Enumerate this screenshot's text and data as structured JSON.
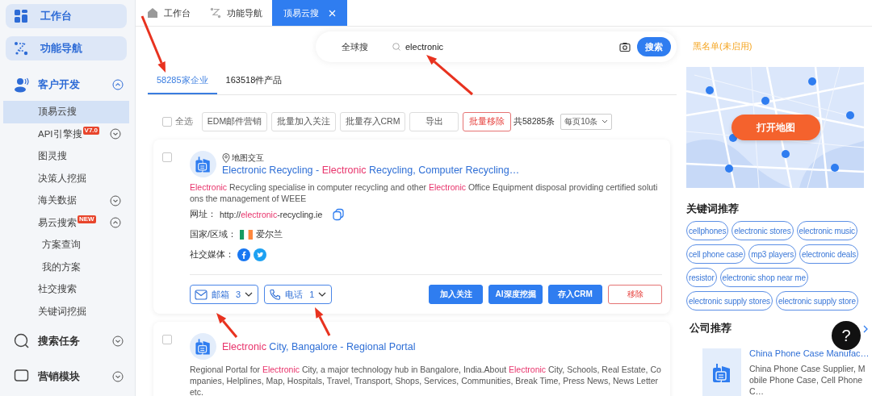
{
  "sidebar": {
    "pinned": [
      {
        "label": "工作台",
        "kind": "workbench"
      },
      {
        "label": "功能导航",
        "kind": "navigation"
      }
    ],
    "groups": [
      {
        "label": "客户开发",
        "kind": "customer",
        "expanded": true,
        "items": [
          {
            "label": "顶易云搜",
            "selected": true
          },
          {
            "label": "API引擎搜",
            "selected": false,
            "badge": "V7.0",
            "expanded": false
          },
          {
            "label": "图灵搜",
            "selected": false
          },
          {
            "label": "决策人挖掘",
            "selected": false
          },
          {
            "label": "海关数据",
            "selected": false,
            "expanded": false
          },
          {
            "label": "易云搜索",
            "selected": false,
            "badge": "NEW",
            "expanded": true,
            "children": [
              {
                "label": "方案查询",
                "selected": false
              },
              {
                "label": "我的方案",
                "selected": false
              }
            ]
          },
          {
            "label": "社交搜索",
            "selected": false
          },
          {
            "label": "关键词挖掘",
            "selected": false
          }
        ]
      },
      {
        "label": "搜索任务",
        "kind": "search",
        "expanded": false
      },
      {
        "label": "营销模块",
        "kind": "marketing",
        "expanded": false
      }
    ]
  },
  "tabs": [
    {
      "label": "工作台",
      "kind": "home",
      "selected": false
    },
    {
      "label": "功能导航",
      "kind": "navigation",
      "selected": false
    },
    {
      "label": "顶易云搜",
      "kind": "page",
      "selected": true
    }
  ],
  "search": {
    "scope": "全球搜",
    "value": "electronic",
    "button": "搜索"
  },
  "result_tabs": [
    {
      "label": "58285家企业",
      "selected": true
    },
    {
      "label": "163518件产品",
      "selected": false
    }
  ],
  "toolbar": {
    "select_all": {
      "label": "全选",
      "checked": false
    },
    "buttons": [
      {
        "label": "EDM邮件营销",
        "kind": "default"
      },
      {
        "label": "批量加入关注",
        "kind": "default"
      },
      {
        "label": "批量存入CRM",
        "kind": "default"
      },
      {
        "label": "导出",
        "kind": "default"
      },
      {
        "label": "批量移除",
        "kind": "danger"
      }
    ],
    "total": "共58285条",
    "page_size": "每页10条"
  },
  "results": [
    {
      "checked": false,
      "map_label": "地图交互",
      "title": [
        {
          "text": "Electronic Recycling - ",
          "highlight": false
        },
        {
          "text": "Electronic",
          "highlight": true
        },
        {
          "text": " Recycling, Computer Recycling…",
          "highlight": false
        }
      ],
      "description": [
        {
          "text": "Electronic",
          "highlight": true
        },
        {
          "text": " Recycling specialise in computer recycling and other ",
          "highlight": false
        },
        {
          "text": "Electronic",
          "highlight": true
        },
        {
          "text": " Office Equipment disposal providing certified solutions the management of WEEE",
          "highlight": false
        }
      ],
      "website": {
        "label": "网址：",
        "value": [
          {
            "text": "http://",
            "highlight": false
          },
          {
            "text": "electronic",
            "highlight": true
          },
          {
            "text": "-recycling.ie",
            "highlight": false
          }
        ]
      },
      "country": {
        "label": "国家/区域：",
        "value": "爱尔兰"
      },
      "social": {
        "label": "社交媒体：",
        "networks": [
          {
            "kind": "facebook"
          },
          {
            "kind": "twitter"
          }
        ]
      },
      "contacts": [
        {
          "kind": "email",
          "label": "邮箱",
          "count": "3"
        },
        {
          "kind": "phone",
          "label": "电话",
          "count": "1"
        }
      ],
      "actions": [
        {
          "label": "加入关注",
          "kind": "primary"
        },
        {
          "label": "AI深度挖掘",
          "kind": "primary"
        },
        {
          "label": "存入CRM",
          "kind": "primary"
        },
        {
          "label": "移除",
          "kind": "danger"
        }
      ]
    },
    {
      "checked": false,
      "title": [
        {
          "text": "Electronic",
          "highlight": true
        },
        {
          "text": " City, Bangalore - Regional Portal",
          "highlight": false
        }
      ],
      "description": [
        {
          "text": "Regional Portal for ",
          "highlight": false
        },
        {
          "text": "Electronic",
          "highlight": true
        },
        {
          "text": " City, a major technology hub in Bangalore, India.About ",
          "highlight": false
        },
        {
          "text": "Electronic",
          "highlight": true
        },
        {
          "text": " City, Schools, Real Estate, Companies, Helplines, Map, Hospitals, Travel, Transport, Shops, Services, Communities, Break Time, Press News, News Letter etc.",
          "highlight": false
        }
      ]
    }
  ],
  "blacklist": "黑名单(未启用)",
  "map": {
    "button": "打开地图"
  },
  "keywords": {
    "title": "关键词推荐",
    "items": [
      "cellphones",
      "electronic stores",
      "electronic music",
      "cell phone case",
      "mp3 players",
      "electronic deals",
      "resistor",
      "electronic shop near me",
      "electronic supply stores",
      "electronic supply store"
    ]
  },
  "companies": {
    "title": "公司推荐",
    "items": [
      {
        "title": "China Phone Case Manufac…",
        "description": "China Phone Case Supplier, Mobile Phone Case, Cell Phone C…"
      }
    ]
  },
  "help": "?"
}
